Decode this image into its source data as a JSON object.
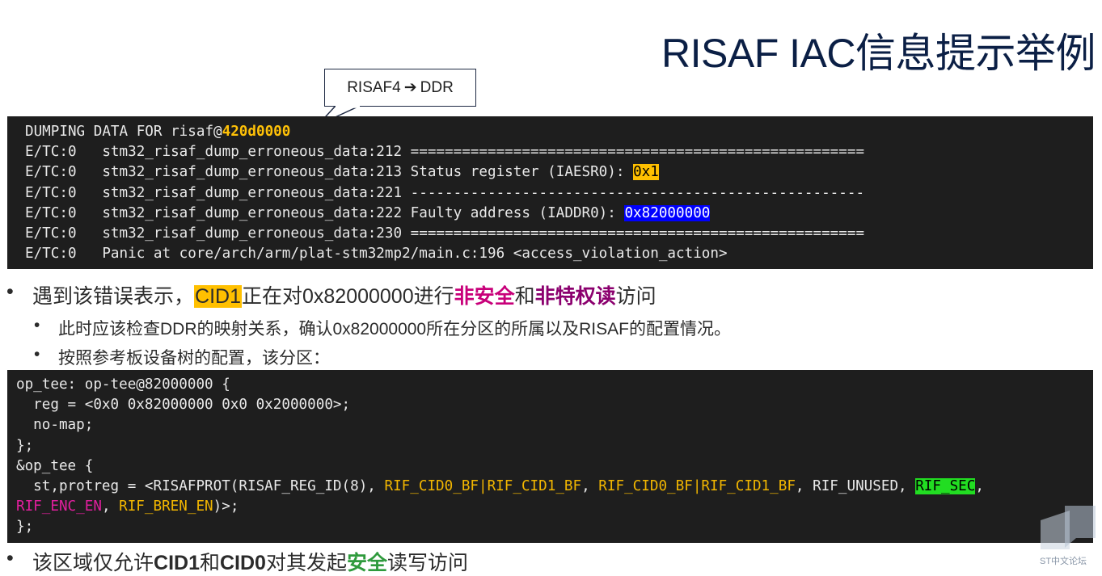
{
  "title": "RISAF IAC信息提示举例",
  "callout": {
    "left": "RISAF4",
    "arrow": "➔",
    "right": "DDR"
  },
  "log": {
    "l1_prefix": "DUMPING DATA FOR risaf@",
    "l1_addr": "420d0000",
    "l2": "E/TC:0   stm32_risaf_dump_erroneous_data:212 =====================================================",
    "l3_prefix": "E/TC:0   stm32_risaf_dump_erroneous_data:213 Status register (IAESR0): ",
    "l3_val": "0x1",
    "l4": "E/TC:0   stm32_risaf_dump_erroneous_data:221 -----------------------------------------------------",
    "l5_prefix": "E/TC:0   stm32_risaf_dump_erroneous_data:222 Faulty address (IADDR0): ",
    "l5_val": "0x82000000",
    "l6": "E/TC:0   stm32_risaf_dump_erroneous_data:230 =====================================================",
    "l7": "E/TC:0   Panic at core/arch/arm/plat-stm32mp2/main.c:196 <access_violation_action>"
  },
  "bullet1": {
    "dot": "•",
    "t1": "遇到该错误表示，",
    "cid": "CID1",
    "t2": "正在对0x82000000进行",
    "nonsec": "非安全",
    "t3": "和",
    "nonpriv": "非特权读",
    "t4": "访问"
  },
  "bullet2": {
    "dot": "•",
    "text": "此时应该检查DDR的映射关系，确认0x82000000所在分区的所属以及RISAF的配置情况。"
  },
  "bullet3": {
    "dot": "•",
    "text": "按照参考板设备树的配置，该分区："
  },
  "dts": {
    "l1": "op_tee: op-tee@82000000 {",
    "l2": "  reg = <0x0 0x82000000 0x0 0x2000000>;",
    "l3": "  no-map;",
    "l4": "};",
    "l5": "&op_tee {",
    "l6_a": "  st,protreg = <RISAFPROT(RISAF_REG_ID(8), ",
    "l6_b": "RIF_CID0_BF|RIF_CID1_BF",
    "l6_c": ", ",
    "l6_d": "RIF_CID0_BF|RIF_CID1_BF",
    "l6_e": ", RIF_UNUSED, ",
    "l6_f": "RIF_SEC",
    "l6_g": ",",
    "l7_a": "RIF_ENC_EN",
    "l7_b": ", ",
    "l7_c": "RIF_BREN_EN",
    "l7_d": ")>;",
    "l8": "};"
  },
  "bullet4": {
    "dot": "•",
    "t1": "该区域仅允许",
    "cid1": "CID1",
    "t2": "和",
    "cid0": "CID0",
    "t3": "对其发起",
    "sec": "安全",
    "t4": "读写访问"
  },
  "watermark": {
    "text": "ST中文论坛"
  },
  "colors": {
    "terminal_bg": "#1e1e1e",
    "title": "#0b1f45",
    "highlight_yellow": "#ffc000",
    "highlight_blue": "#0000ff",
    "highlight_green": "#22dd22"
  }
}
